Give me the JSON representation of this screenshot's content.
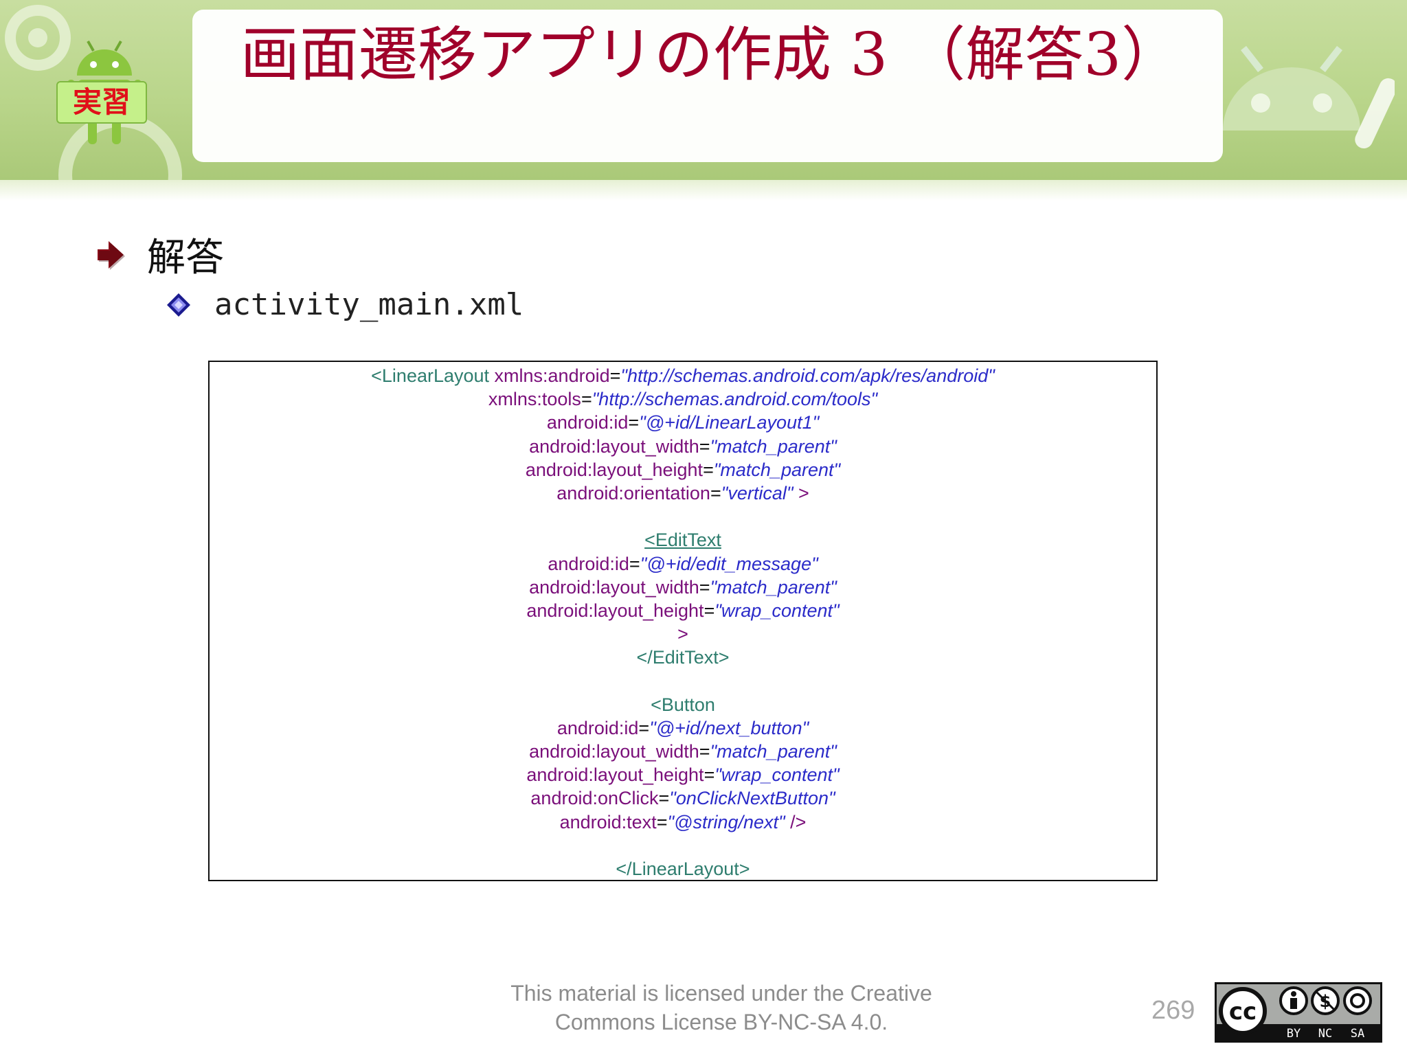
{
  "header": {
    "title": "画面遷移アプリの作成 3 （解答3）",
    "badge": "実習"
  },
  "bullets": {
    "level1": "解答",
    "level2": "activity_main.xml"
  },
  "code_lines": [
    [
      {
        "t": "<LinearLayout ",
        "c": "tag"
      },
      {
        "t": "xmlns:android",
        "c": "attr"
      },
      {
        "t": "=",
        "c": "eq"
      },
      {
        "t": "\"http://schemas.android.com/apk/res/android\"",
        "c": "val"
      }
    ],
    [
      {
        "t": "xmlns:tools",
        "c": "attr"
      },
      {
        "t": "=",
        "c": "eq"
      },
      {
        "t": "\"http://schemas.android.com/tools\"",
        "c": "val"
      }
    ],
    [
      {
        "t": "android:id",
        "c": "attr"
      },
      {
        "t": "=",
        "c": "eq"
      },
      {
        "t": "\"@+id/LinearLayout1\"",
        "c": "val"
      }
    ],
    [
      {
        "t": "android:layout_width",
        "c": "attr"
      },
      {
        "t": "=",
        "c": "eq"
      },
      {
        "t": "\"match_parent\"",
        "c": "val"
      }
    ],
    [
      {
        "t": "android:layout_height",
        "c": "attr"
      },
      {
        "t": "=",
        "c": "eq"
      },
      {
        "t": "\"match_parent\"",
        "c": "val"
      }
    ],
    [
      {
        "t": "android:orientation",
        "c": "attr"
      },
      {
        "t": "=",
        "c": "eq"
      },
      {
        "t": "\"vertical\"",
        "c": "val"
      },
      {
        "t": " >",
        "c": "punct"
      }
    ],
    [],
    [
      {
        "t": "<EditText",
        "c": "tag-u"
      }
    ],
    [
      {
        "t": "android:id",
        "c": "attr"
      },
      {
        "t": "=",
        "c": "eq"
      },
      {
        "t": "\"@+id/edit_message\"",
        "c": "val"
      }
    ],
    [
      {
        "t": "android:layout_width",
        "c": "attr"
      },
      {
        "t": "=",
        "c": "eq"
      },
      {
        "t": "\"match_parent\"",
        "c": "val"
      }
    ],
    [
      {
        "t": "android:layout_height",
        "c": "attr"
      },
      {
        "t": "=",
        "c": "eq"
      },
      {
        "t": "\"wrap_content\"",
        "c": "val"
      }
    ],
    [
      {
        "t": ">",
        "c": "punct"
      }
    ],
    [
      {
        "t": "</EditText>",
        "c": "tag"
      }
    ],
    [],
    [
      {
        "t": "<Button",
        "c": "tag"
      }
    ],
    [
      {
        "t": "android:id",
        "c": "attr"
      },
      {
        "t": "=",
        "c": "eq"
      },
      {
        "t": "\"@+id/next_button\"",
        "c": "val"
      }
    ],
    [
      {
        "t": "android:layout_width",
        "c": "attr"
      },
      {
        "t": "=",
        "c": "eq"
      },
      {
        "t": "\"match_parent\"",
        "c": "val"
      }
    ],
    [
      {
        "t": "android:layout_height",
        "c": "attr"
      },
      {
        "t": "=",
        "c": "eq"
      },
      {
        "t": "\"wrap_content\"",
        "c": "val"
      }
    ],
    [
      {
        "t": "android:onClick",
        "c": "attr"
      },
      {
        "t": "=",
        "c": "eq"
      },
      {
        "t": "\"onClickNextButton\"",
        "c": "val"
      }
    ],
    [
      {
        "t": "android:text",
        "c": "attr"
      },
      {
        "t": "=",
        "c": "eq"
      },
      {
        "t": "\"@string/next\"",
        "c": "val"
      },
      {
        "t": " />",
        "c": "punct"
      }
    ],
    [],
    [
      {
        "t": "</LinearLayout>",
        "c": "tag"
      }
    ]
  ],
  "footer": {
    "license_line1": "This material is licensed under the Creative",
    "license_line2": "Commons License BY-NC-SA 4.0.",
    "page_number": "269"
  },
  "cc_badge": {
    "main": "cc",
    "by": "BY",
    "nc": "NC",
    "sa": "SA"
  },
  "colors": {
    "title": "#a0002a",
    "banner": "#b9d58a",
    "tag": "#2e7d6e",
    "attr": "#7a0f7a",
    "value": "#2b2bc9"
  }
}
